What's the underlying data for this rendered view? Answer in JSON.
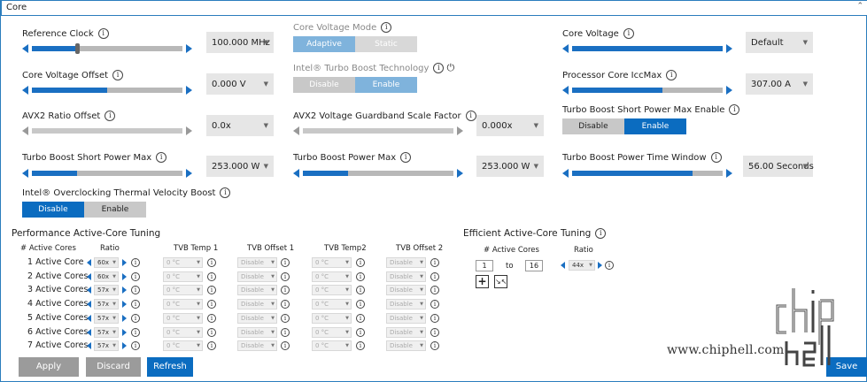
{
  "section": {
    "title": "Core",
    "collapse_icon": "chevron-up-icon"
  },
  "core": {
    "reference_clock": {
      "label": "Reference Clock",
      "value": "100.000 MHz",
      "fill": 0.3
    },
    "core_voltage_mode": {
      "label": "Core Voltage Mode",
      "options": [
        "Adaptive",
        "Static"
      ],
      "selected": "Adaptive"
    },
    "core_voltage": {
      "label": "Core Voltage",
      "value": "Default",
      "fill": 1.0
    },
    "core_voltage_offset": {
      "label": "Core Voltage Offset",
      "value": "0.000 V",
      "fill": 0.5
    },
    "turbo_boost_tech": {
      "label": "Intel® Turbo Boost Technology",
      "options": [
        "Disable",
        "Enable"
      ],
      "selected": "Enable"
    },
    "processor_iccmax": {
      "label": "Processor Core IccMax",
      "value": "307.00 A",
      "fill": 0.6
    },
    "avx2_ratio_offset": {
      "label": "AVX2 Ratio Offset",
      "value": "0.0x",
      "fill": 0.0
    },
    "avx2_guardband": {
      "label": "AVX2 Voltage Guardband Scale Factor",
      "value": "0.000x",
      "fill": 0.0
    },
    "short_power_max_enable": {
      "label": "Turbo Boost Short Power Max Enable",
      "options": [
        "Disable",
        "Enable"
      ],
      "selected": "Enable"
    },
    "short_power_max": {
      "label": "Turbo Boost Short Power Max",
      "value": "253.000 W",
      "fill": 0.3
    },
    "power_max": {
      "label": "Turbo Boost Power Max",
      "value": "253.000 W",
      "fill": 0.3
    },
    "power_time_window": {
      "label": "Turbo Boost Power Time Window",
      "value": "56.00 Seconds",
      "fill": 0.8
    },
    "tvb": {
      "label": "Intel® Overclocking Thermal Velocity Boost",
      "options": [
        "Disable",
        "Enable"
      ],
      "selected": "Disable"
    }
  },
  "perf_tuning": {
    "title": "Performance Active-Core Tuning",
    "headers": [
      "# Active Cores",
      "Ratio",
      "TVB Temp 1",
      "TVB Offset 1",
      "TVB Temp2",
      "TVB Offset 2"
    ],
    "rows": [
      {
        "label": "1 Active Core",
        "ratio": "60x",
        "temp1": "0 °C",
        "offset1": "Disable",
        "temp2": "0 °C",
        "offset2": "Disable"
      },
      {
        "label": "2 Active Cores",
        "ratio": "60x",
        "temp1": "0 °C",
        "offset1": "Disable",
        "temp2": "0 °C",
        "offset2": "Disable"
      },
      {
        "label": "3 Active Cores",
        "ratio": "57x",
        "temp1": "0 °C",
        "offset1": "Disable",
        "temp2": "0 °C",
        "offset2": "Disable"
      },
      {
        "label": "4 Active Cores",
        "ratio": "57x",
        "temp1": "0 °C",
        "offset1": "Disable",
        "temp2": "0 °C",
        "offset2": "Disable"
      },
      {
        "label": "5 Active Cores",
        "ratio": "57x",
        "temp1": "0 °C",
        "offset1": "Disable",
        "temp2": "0 °C",
        "offset2": "Disable"
      },
      {
        "label": "6 Active Cores",
        "ratio": "57x",
        "temp1": "0 °C",
        "offset1": "Disable",
        "temp2": "0 °C",
        "offset2": "Disable"
      },
      {
        "label": "7 Active Cores",
        "ratio": "57x",
        "temp1": "0 °C",
        "offset1": "Disable",
        "temp2": "0 °C",
        "offset2": "Disable"
      }
    ]
  },
  "eff_tuning": {
    "title": "Efficient Active-Core Tuning",
    "headers": [
      "# Active Cores",
      "Ratio"
    ],
    "from": "1",
    "to_label": "to",
    "to": "16",
    "ratio": "44x"
  },
  "actions": {
    "apply": "Apply",
    "discard": "Discard",
    "refresh": "Refresh",
    "save": "Save"
  },
  "watermark": {
    "text": "www.chiphell.com"
  },
  "colors": {
    "accent": "#0b6cc0",
    "disabled": "#9b9b9b"
  }
}
